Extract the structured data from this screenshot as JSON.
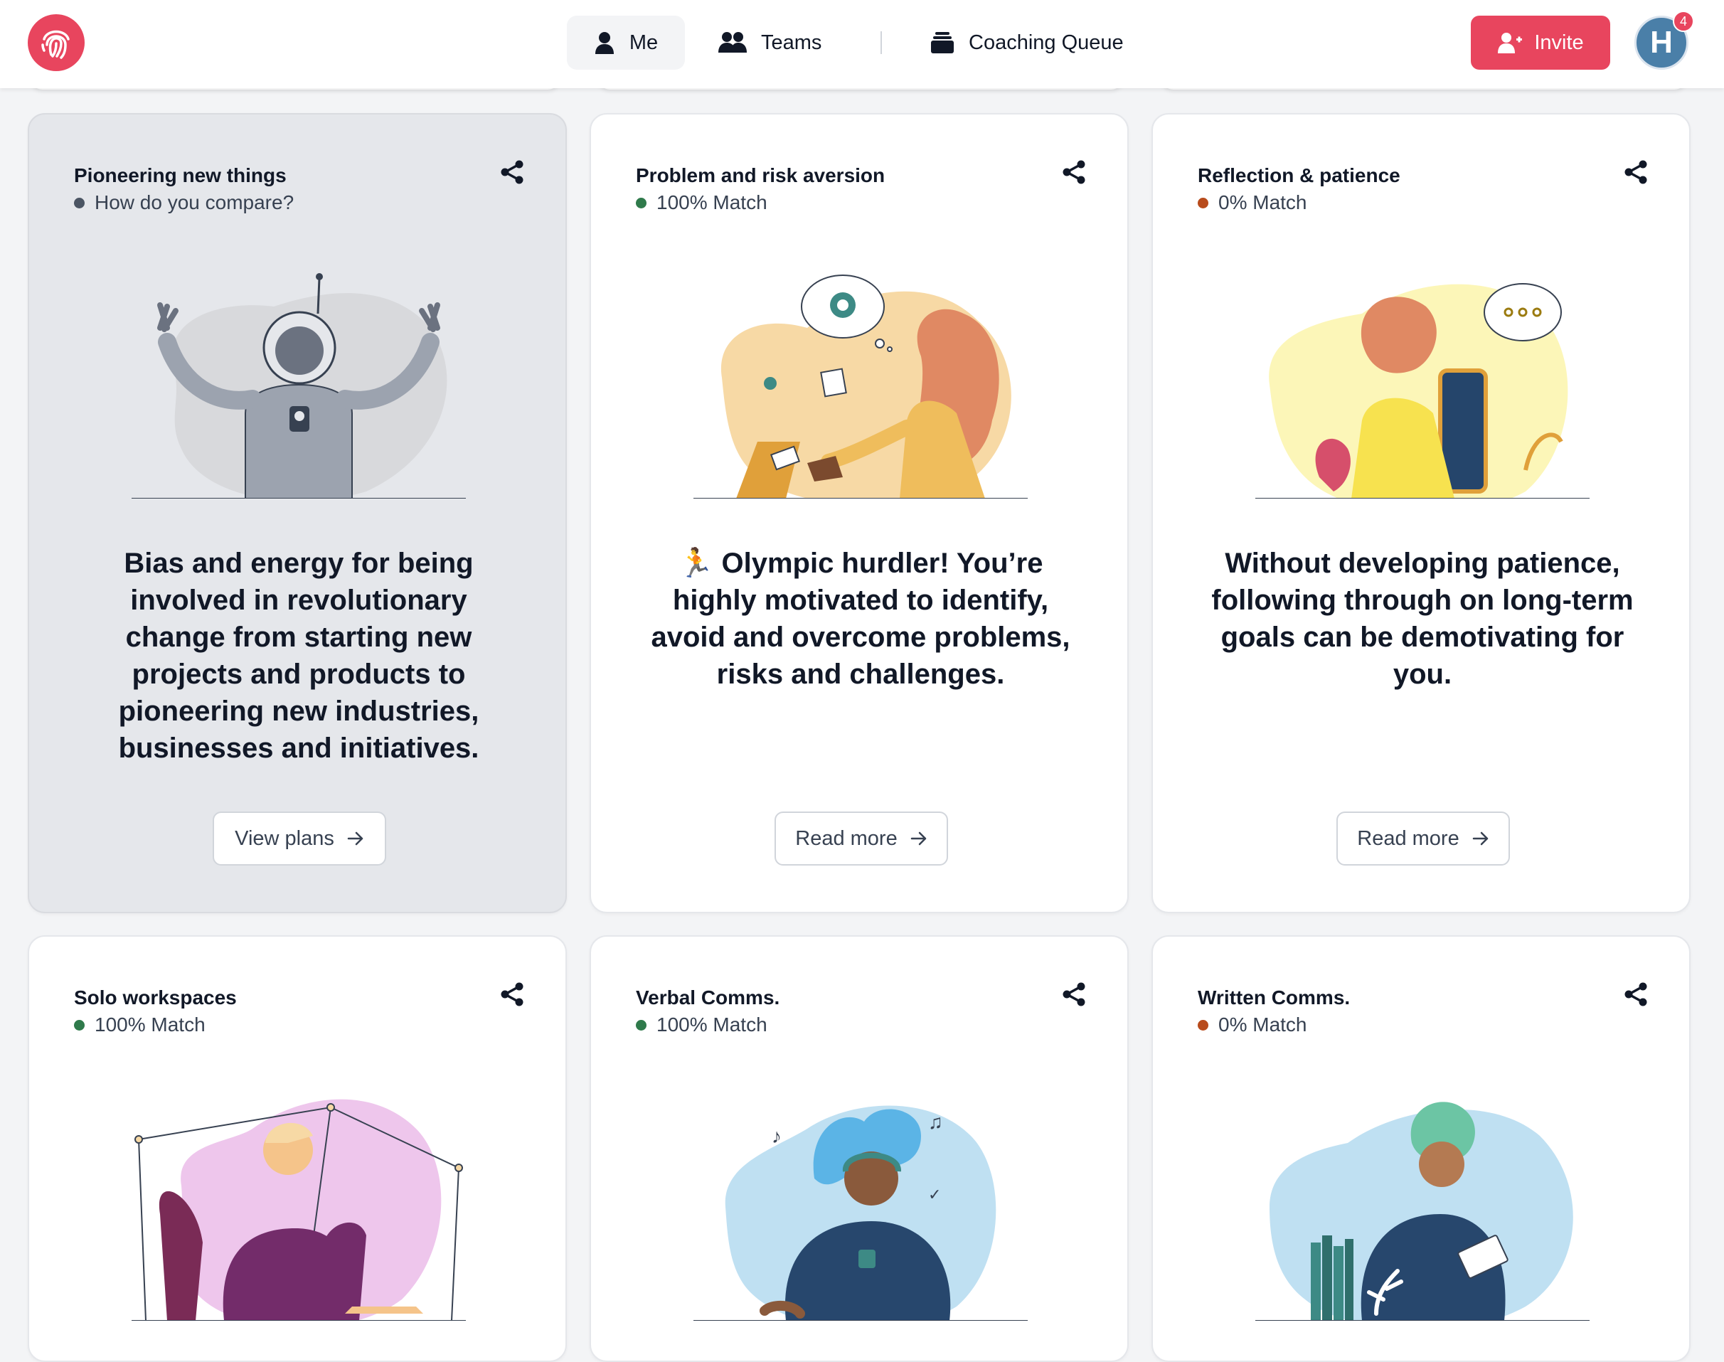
{
  "nav": {
    "me": "Me",
    "teams": "Teams",
    "coaching_queue": "Coaching Queue",
    "invite": "Invite",
    "avatar_initial": "H",
    "notification_count": "4"
  },
  "colors": {
    "brand": "#e8455e",
    "match_green": "#2f7a4b",
    "match_orange": "#b84b1c",
    "neutral_dot": "#4b5563"
  },
  "cards": [
    {
      "title": "Pioneering new things",
      "subtitle": "How do you compare?",
      "status": "neutral",
      "description": "Bias and energy for being involved in revolutionary change from starting new projects and products to pioneering new industries, businesses and initiatives.",
      "button": "View plans",
      "illustration": "astronaut-illustration"
    },
    {
      "title": "Problem and risk aversion",
      "subtitle": "100% Match",
      "status": "match",
      "description": "🏃 Olympic hurdler! You’re highly motivated to identify, avoid and overcome problems, risks and challenges.",
      "button": "Read more",
      "illustration": "desk-worker-illustration"
    },
    {
      "title": "Reflection & patience",
      "subtitle": "0% Match",
      "status": "nomatch",
      "description": "Without developing patience, following through on long-term goals can be demotivating for you.",
      "button": "Read more",
      "illustration": "thinking-woman-illustration"
    },
    {
      "title": "Solo workspaces",
      "subtitle": "100% Match",
      "status": "match",
      "illustration": "solo-worker-illustration"
    },
    {
      "title": "Verbal Comms.",
      "subtitle": "100% Match",
      "status": "match",
      "illustration": "headphones-listener-illustration"
    },
    {
      "title": "Written Comms.",
      "subtitle": "0% Match",
      "status": "nomatch",
      "illustration": "reader-illustration"
    }
  ]
}
